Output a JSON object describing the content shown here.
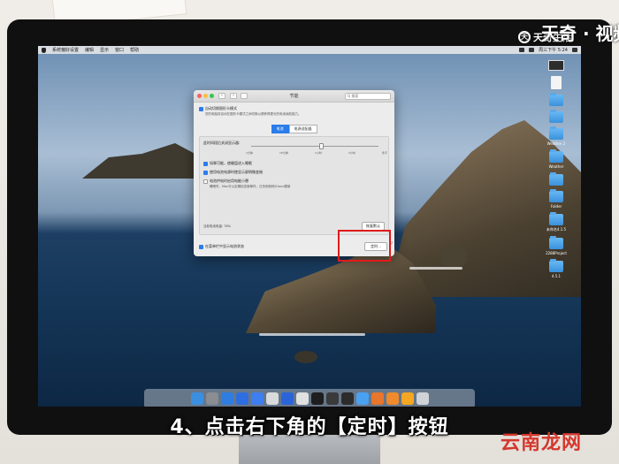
{
  "menubar": {
    "app_name": "系统偏好设置",
    "items": [
      "编辑",
      "显示",
      "窗口",
      "帮助"
    ],
    "clock": "周三下午 5:24"
  },
  "desktop_icons": [
    {
      "label": "",
      "kind": "screenshot"
    },
    {
      "label": "",
      "kind": "document"
    },
    {
      "label": "",
      "kind": "folder"
    },
    {
      "label": "",
      "kind": "folder"
    },
    {
      "label": "Weather 2",
      "kind": "folder"
    },
    {
      "label": "Weather",
      "kind": "folder"
    },
    {
      "label": "",
      "kind": "folder"
    },
    {
      "label": "Folder",
      "kind": "folder"
    },
    {
      "label": "未命名4.1.5",
      "kind": "folder"
    },
    {
      "label": "2288Project",
      "kind": "folder"
    },
    {
      "label": "4.5.1",
      "kind": "folder"
    }
  ],
  "window": {
    "title": "节能",
    "search_placeholder": "Q 搜索",
    "auto_switch_label": "自动切换图形卡模式",
    "auto_switch_desc": "您的电脑将自动在图形卡模式之间切换以便获得更长的电池续航能力。",
    "tabs": [
      "电池",
      "电源适配器"
    ],
    "slider_label": "此时间段后关闭显示器:",
    "slider_ticks": [
      "1分钟",
      "15分钟",
      "1小时",
      "3小时",
      "永不"
    ],
    "slider_value_fraction": 0.55,
    "options": [
      {
        "label": "如果可能，使硬盘进入睡眠",
        "checked": true
      },
      {
        "label": "使用电池电源时使显示屏稍微变暗",
        "checked": true
      },
      {
        "label": "电池供电时启用电能小憩",
        "checked": false
      }
    ],
    "power_nap_desc": "睡眠时，Mac可以定期检查新邮件、日历和其他iCloud更新",
    "battery_status": "当前电池电量: 78%",
    "restore_button": "恢复默认",
    "menu_bar_option": "在菜单栏中显示电池状态",
    "schedule_button": "定时...",
    "help": "?"
  },
  "dock_colors": [
    "#3b8fe0",
    "#8a8d91",
    "#2f7de0",
    "#2d6ee0",
    "#3e7ff0",
    "#d8dadc",
    "#2a64d8",
    "#e0e0e0",
    "#1e1e1e",
    "#3a3a3a",
    "#2c2c2c",
    "#4aa1f0",
    "#e8762c",
    "#f08a2c",
    "#f5a623",
    "#cfd3d8"
  ],
  "subtitle": "4、点击右下角的【定时】按钮",
  "watermarks": {
    "top_logo": "天",
    "top_text": "天奇生活",
    "top_right": "天奇 · 视频",
    "bottom_right": "云南龙网"
  },
  "colors": {
    "accent": "#2b7de9",
    "highlight": "#e01a1a",
    "watermark_red": "#d4382e"
  }
}
